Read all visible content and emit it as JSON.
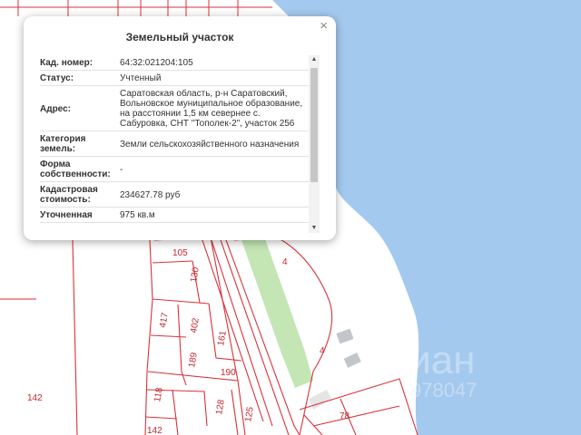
{
  "popup": {
    "title": "Земельный участок",
    "close_symbol": "×",
    "rows": [
      {
        "key": "Кад. номер",
        "colon": ":",
        "value": "64:32:021204:105"
      },
      {
        "key": "Статус",
        "colon": ":",
        "value": "Учтенный"
      },
      {
        "key": "Адрес",
        "colon": ":",
        "value": "Саратовская область, р-н Саратовский, Вольновское муниципальное образование, на расстоянии 1,5 км севернее с. Сабуровка, СНТ \"Тополек-2\", участок 256"
      },
      {
        "key": "Категория земель",
        "colon": ":",
        "value": "Земли сельскохозяйственного назначения"
      },
      {
        "key": "Форма собственности",
        "colon": ":",
        "value": "-"
      },
      {
        "key": "Кадастровая стоимость",
        "colon": ":",
        "value": "234627.78 руб"
      },
      {
        "key": "Уточненная",
        "colon": "",
        "value": "975 кв.м"
      }
    ],
    "scrollbar": {
      "up_icon": "▲",
      "down_icon": "▼",
      "scroll_position": 0.1
    }
  },
  "map": {
    "parcel_labels": [
      "105",
      "130",
      "4",
      "417",
      "402",
      "161",
      "189",
      "190",
      "4",
      "142",
      "118",
      "128",
      "125",
      "78",
      "142"
    ],
    "watermark": "циан",
    "watermark_id": "978047",
    "colors": {
      "water": "#a4c9ee",
      "boundary": "#d9323b",
      "strip": "#c3e6b4",
      "label": "#c0262d"
    }
  }
}
